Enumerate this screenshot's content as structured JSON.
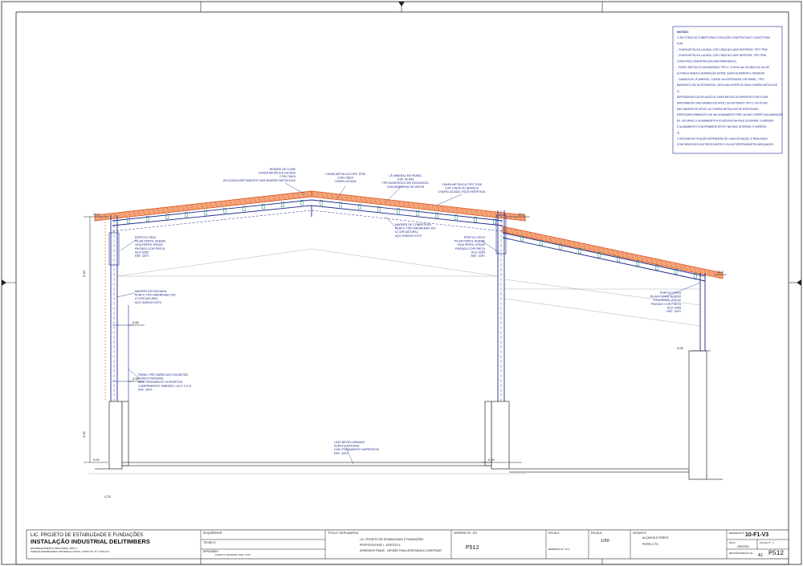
{
  "notes": {
    "heading": "NOTAS:",
    "lines": [
      "1) EM TODAS AS COBERTURAS A SOLUÇÃO CONSTRUTIVA É CONSTITUÍDA",
      "POR:",
      "- CHAPA METÁLICA LACADA, COR CINZA NO LADO SUPERIOR, TIPO TR35",
      "- CHAPA METÁLICA LACADA, COR CINZA NO LADO INFERIOR, TIPO TR35",
      "COM A FACE INVERTIDA (VOLTADA PARA BAIXO)",
      "- PERFIL METÁLICO GALVANIZADO TIPO Z, COM 60 mm DE ABA E 80 mm DE",
      "ALTURA A FAZER A SEPARAÇÃO ENTRE CHAPA SUPERIOR E INFERIOR",
      "- CAMADA DE LÃ MINERAL, COM 80 mm ESPESSURA, EM PAINEL, TIPO",
      "BASEROCK 300 DA ROCKWOOL, APLICADA ENTRE AS DUAS CHAPAS METÁLICAS",
      "2)",
      "DEPENDENDO DA SITUAÇÃO A CHAPA METÁLICA SUPERIOR PODE FICAR",
      "DIRETAMENTE NAS MADRES DE APOIO OU EM PERFIS TIPO Z 100 FICAM",
      "NAS MADRES DE APOIO. AS CHAPAS METÁLICAS DE ESPESSURA",
      "ESPESSURA MÍNIMA DE 0,65 mm ACABAMENTO PRÉ-LACADO SOBRE GALVANIZAÇÃO",
      "DE 140 GR/M2, E ACABAMENTO A POLIÉSTER NA FACE EXTERIOR, E MORENO",
      "E ACABAMENTO COM PRIMÁRIO EPOXY NA FACE INTERIOR, E MORENO",
      "3)",
      "O SISTEMA DE FIXAÇÃO DEPENDERÁ DE CADA SITUAÇÃO, E REALIZADO",
      "COM PARAFUSOS AUTOROSCANTES E OU AUTOPERFURANTES ADEQUADOS"
    ]
  },
  "annotations": {
    "remate": [
      "REMATE DE CUME",
      "CHAPA METÁLICA LACADA",
      "COR CINZA",
      "APLICADA DIRETAMENTE NAS MADRES METÁLICAS"
    ],
    "chapa_tr35_left": [
      "CHAPA METÁLICA TIPO TR35",
      "COR CINZA",
      "CHAPA LACADA"
    ],
    "la_mineral": [
      "LÃ MINERAL EM PAINEL",
      "ESP. 80 MM",
      "TIPO BASEROCK 300 ROCKWOOL",
      "COM BARREIRA DE VAPOR"
    ],
    "chapa_tr35_right": [
      "CHAPA METÁLICA TIPO TR35",
      "COR CINZA OU BRANCA",
      "CHAPA LACADA, FACE INVERTIDA"
    ],
    "portico_left": [
      "PÓRTICO PR13",
      "PILAR PERFIL HEB360",
      "VIGA PERFIL IPE400",
      "PINTADO COR PRETA",
      "AÇO S355",
      "REF: 20P1"
    ],
    "madres_cobertura": [
      "MADRES DE COBERTURA",
      "PERFIL TIPO MADREMAX 200",
      "A COR NATURAL",
      "AÇO S450GD+Z275"
    ],
    "portico_mid": [
      "PÓRTICO PR13",
      "PILAR PERFIL HEB360",
      "VIGA PERFIL IPE400",
      "PINTADO COR PRETA",
      "AÇO S355",
      "REF: 20P1"
    ],
    "madres_fachada": [
      "MADRES DE FACHADA",
      "PERFIL TIPO MADREMAX 200",
      "A COR NATURAL",
      "AÇO S450GD+Z275"
    ],
    "portico_right": [
      "PÓRTICO PR14",
      "PILAR PERFIL HEB200",
      "VIGA PERFIL IPE240",
      "PINTADO COR PRETA",
      "AÇO S355",
      "REF: 20P1"
    ],
    "painel": [
      "PAINEL PRÉ-FABRICADO EM BETÃO",
      "ASPETO NATURAL",
      "SEM TRATAMENTO SUPERFÍCIE",
      "COMPRIMENTO VARIÁVEL x ALT. 2,5 m",
      "REF: 20P1"
    ],
    "laje": [
      "LAJE BETÃO ARMADO",
      "ASPETO NATURAL",
      "COM TRATAMENTO SUPERFÍCIE",
      "REF: 20P1"
    ],
    "cts": "CTS"
  },
  "levels": {
    "left_top": "16,0",
    "left_mid": "6,65",
    "left_low": "3,35",
    "left_ground": "0,00",
    "mid_top": "16,0",
    "mid_ground": "0,00",
    "right_top": "10,0",
    "right_low": "3,00",
    "dim_a": "9,40",
    "dim_b": "3,35"
  },
  "title_block": {
    "org_line": "LIC. PROJETO DE ESTABILIDADE E FUNDAÇÕES",
    "project": "INSTALAÇÃO INDUSTRIAL DELITIMBERS",
    "sub1": "ESTABELECIMENTO INDUSTRIAL TIPO 3",
    "sub2": "PARQUE EMPRESARIAL PROENÇA A NOVA, LOTES P.6, P.7, P.8 E P.9",
    "field_requerente": "REQUERENTE:",
    "field_tecnico": "TÉCNICO:",
    "field_aprovado": "APROVADO",
    "aprovado_val": "CHAVE S. MACHADO, ENG. CIVIL",
    "titulo_label": "TÍTULO: DEPLANIFIKA",
    "titulo_lines": [
      "LIC. PROJETO DE ESTABILIDADE E FUNDAÇÕES",
      "PROPOSTA FASE I - EDIFÍCIO 3",
      "DESENHOS FINAIS - VERSÃO FINAL APROVADA A CONSTRUIR"
    ],
    "desenho_label": "DESENHO Nº. 123",
    "desenho_sign": "P512",
    "escala_label": "ESCALA",
    "escala_extra": "DESENHO Nº. 10-1",
    "scale_label": "ESCALA",
    "scale_val": "1/50",
    "assunto_label": "ASSUNTO:",
    "assunto_lines": [
      "ALÇADOS E PERFIS",
      "PERFIL CTS"
    ],
    "codigo_label": "DESENHO Nº.",
    "codigo": "10-F1-V3",
    "data_label": "DATA:",
    "data_val": "2020/2021",
    "folha_label": "FOLHA Nº.",
    "folha_val": "1",
    "revisao_label": "REVISÃO:",
    "revisao_val": "EDIÇÃO 01",
    "format": "A1",
    "sign": "P512"
  }
}
